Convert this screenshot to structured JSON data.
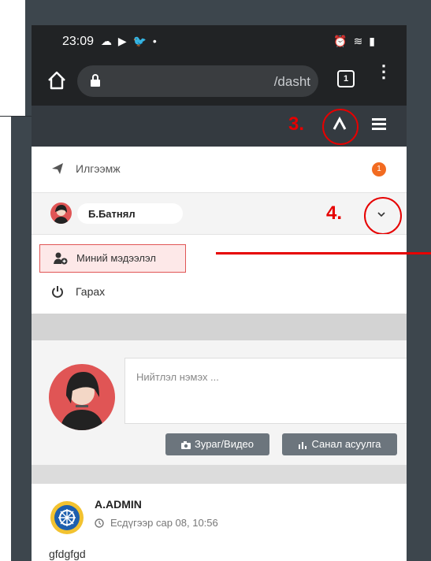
{
  "status_bar": {
    "time": "23:09",
    "left_icons": "☁ ▶ 🐦 •",
    "right_icons": "⏰ ≋ ▮"
  },
  "browser": {
    "url": "/dasht",
    "tab_count": "1"
  },
  "annotations": {
    "step3": "3.",
    "step4": "4.",
    "highlight_color": "#e60000"
  },
  "dropdown": {
    "messages_label": "Илгээмж",
    "messages_count": "1",
    "user_name": "Б.Батнял",
    "profile_label": "Миний мэдээлэл",
    "logout_label": "Гарах"
  },
  "composer": {
    "placeholder": "Нийтлэл нэмэх ...",
    "photo_button": "Зураг/Видео",
    "poll_button": "Санал асуулга"
  },
  "feed": {
    "author": "A.ADMIN",
    "timestamp": "Есдүгээр сар 08, 10:56",
    "text": "gfdgfgd"
  },
  "colors": {
    "navbar": "#343a40",
    "badge": "#f26b21",
    "button": "#6c757d"
  }
}
